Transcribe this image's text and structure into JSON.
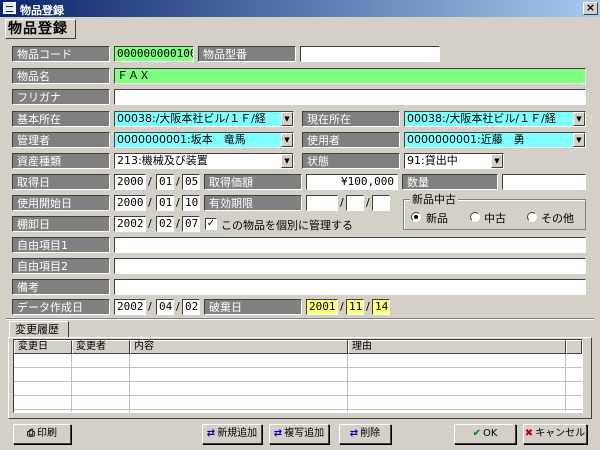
{
  "window": {
    "title": "物品登録"
  },
  "heading": "物品登録",
  "form": {
    "item_code": {
      "label": "物品コード",
      "value": "000000000100"
    },
    "model_no": {
      "label": "物品型番",
      "value": ""
    },
    "item_name": {
      "label": "物品名",
      "value": "ＦＡＸ"
    },
    "furigana": {
      "label": "フリガナ",
      "value": ""
    },
    "base_location": {
      "label": "基本所在",
      "value": "00038:/大阪本社ビル/１Ｆ/経"
    },
    "current_location": {
      "label": "現在所在",
      "value": "00038:/大阪本社ビル/１Ｆ/経"
    },
    "manager": {
      "label": "管理者",
      "value": "0000000001:坂本　竜馬"
    },
    "user": {
      "label": "使用者",
      "value": "0000000001:近藤　勇"
    },
    "asset_type": {
      "label": "資産種類",
      "value": "213:機械及び装置"
    },
    "status": {
      "label": "状態",
      "value": "91:貸出中"
    },
    "acquired_date": {
      "label": "取得日",
      "year": "2000",
      "month": "01",
      "day": "05"
    },
    "acquired_price": {
      "label": "取得価額",
      "value": "¥100,000"
    },
    "quantity": {
      "label": "数量",
      "value": ""
    },
    "use_start_date": {
      "label": "使用開始日",
      "year": "2000",
      "month": "01",
      "day": "10"
    },
    "expiry": {
      "label": "有効期限",
      "year": "",
      "month": "",
      "day": ""
    },
    "inventory_date": {
      "label": "棚卸日",
      "year": "2002",
      "month": "02",
      "day": "07"
    },
    "individual_manage": {
      "label": "この物品を個別に管理する",
      "checked": "✓"
    },
    "condition_group": {
      "title": "新品中古",
      "options": [
        "新品",
        "中古",
        "その他"
      ],
      "selected": "新品"
    },
    "free1": {
      "label": "自由項目1",
      "value": ""
    },
    "free2": {
      "label": "自由項目2",
      "value": ""
    },
    "notes": {
      "label": "備考",
      "value": ""
    },
    "created_date": {
      "label": "データ作成日",
      "year": "2002",
      "month": "04",
      "day": "02"
    },
    "disposal_date": {
      "label": "破棄日",
      "year": "2001",
      "month": "11",
      "day": "14"
    },
    "date_sep": "/"
  },
  "history": {
    "tab_label": "変更履歴",
    "columns": [
      "変更日",
      "変更者",
      "内容",
      "理由"
    ]
  },
  "buttons": {
    "print": "印刷",
    "new_add": "新規追加",
    "copy_add": "複写追加",
    "delete": "削除",
    "ok": "OK",
    "cancel": "キャンセル"
  },
  "icons": {
    "app": "window-app-icon",
    "close": "close-icon",
    "dropdown": "chevron-down-icon",
    "print": "printer-icon",
    "ok": "checkmark-icon",
    "cancel": "x-icon"
  },
  "colors": {
    "field_green": "#80ff80",
    "field_cyan": "#80ffff",
    "field_yellow": "#ffff80",
    "label_gray": "#808080",
    "titlebar": "#0a246a"
  }
}
